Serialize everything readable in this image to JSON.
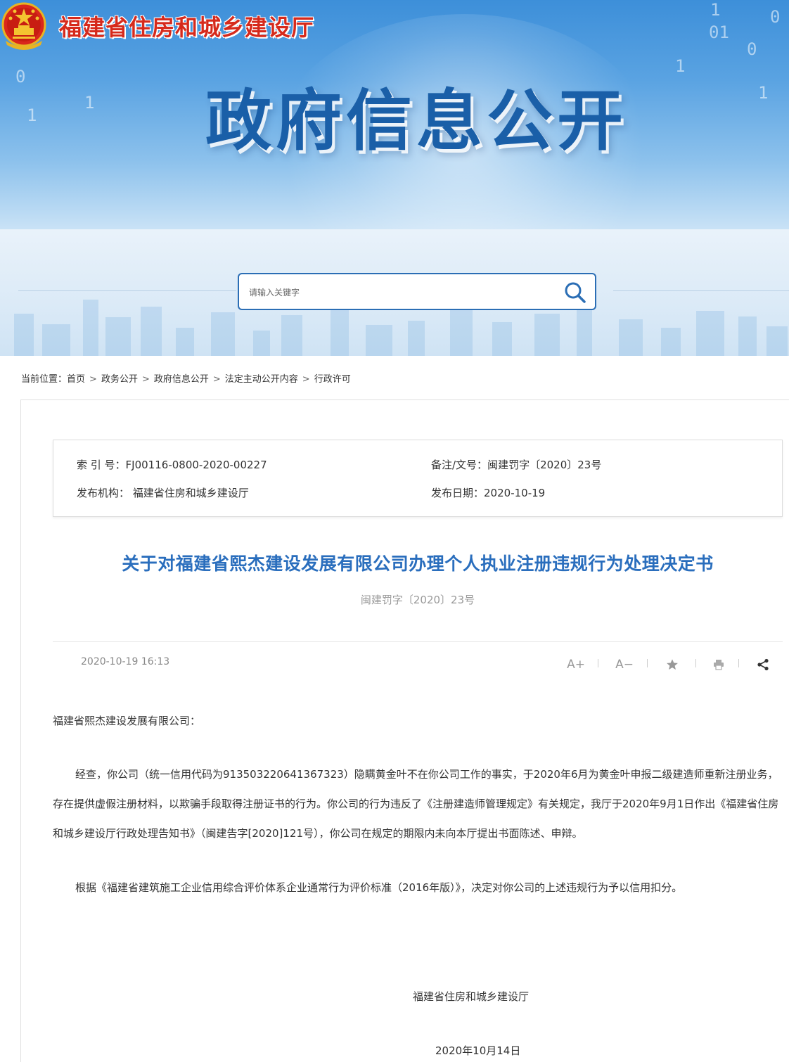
{
  "header": {
    "site_title": "福建省住房和城乡建设厅",
    "banner_title": "政府信息公开",
    "banner_digits": [
      "1",
      "1",
      "0",
      "1",
      "01",
      "0",
      "1",
      "1",
      "0"
    ]
  },
  "search": {
    "placeholder": "请输入关键字"
  },
  "breadcrumb": {
    "prefix": "当前位置：",
    "items": [
      "首页",
      "政务公开",
      "政府信息公开",
      "法定主动公开内容",
      "行政许可"
    ],
    "separator": ">"
  },
  "meta": {
    "index_label": "索 引 号：",
    "index_value": "FJ00116-0800-2020-00227",
    "doc_no_label": "备注/文号：",
    "doc_no_value": "闽建罚字〔2020〕23号",
    "publisher_label": "发布机构：",
    "publisher_value": "福建省住房和城乡建设厅",
    "date_label": "发布日期：",
    "date_value": "2020-10-19"
  },
  "article": {
    "title": "关于对福建省熙杰建设发展有限公司办理个人执业注册违规行为处理决定书",
    "doc_number": "闽建罚字〔2020〕23号",
    "publish_time": "2020-10-19 16:13",
    "salutation": "福建省熙杰建设发展有限公司：",
    "paragraph_1": "经查，你公司（统一信用代码为913503220641367323）隐瞒黄金叶不在你公司工作的事实，于2020年6月为黄金叶申报二级建造师重新注册业务，存在提供虚假注册材料，以欺骗手段取得注册证书的行为。你公司的行为违反了《注册建造师管理规定》有关规定，我厅于2020年9月1日作出《福建省住房和城乡建设厅行政处理告知书》（闽建告字[2020]121号），你公司在规定的期限内未向本厅提出书面陈述、申辩。",
    "paragraph_2": "根据《福建省建筑施工企业信用综合评价体系企业通常行为评价标准（2016年版）》，决定对你公司的上述违规行为予以信用扣分。",
    "signature": "福建省住房和城乡建设厅",
    "sign_date": "2020年10月14日"
  },
  "tools": {
    "font_larger": "A+",
    "font_smaller": "A−",
    "icons": [
      "star-icon",
      "print-icon",
      "share-icon"
    ]
  },
  "colors": {
    "brand_blue": "#2a6ebd",
    "site_title_red": "#d62a1c",
    "banner_title_blue": "#1a5fa8"
  }
}
